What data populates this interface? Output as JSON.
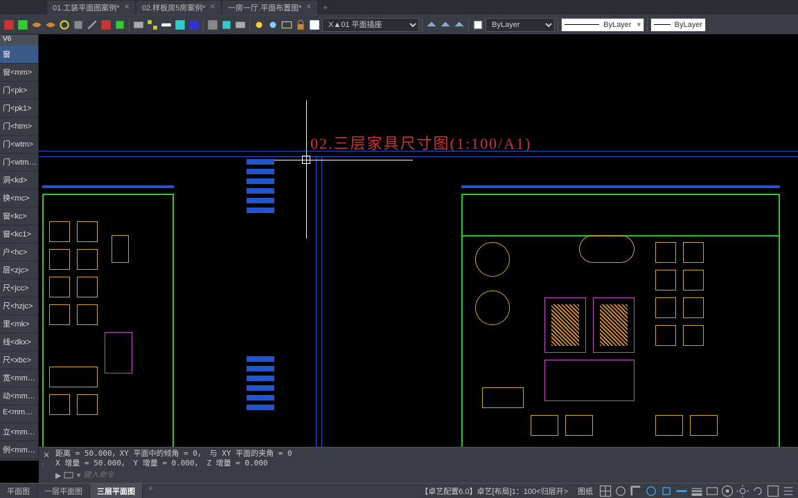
{
  "tabs": [
    {
      "label": "01.工装平面图案例*"
    },
    {
      "label": "02.样板房5房案例*"
    },
    {
      "label": "一房一厅.平面布置图*"
    }
  ],
  "toolbar": {
    "layer_current": "X▲01 平面插座",
    "bylayer1": "ByLayer",
    "bylayer2": "ByLayer",
    "bylayer3": "ByLayer"
  },
  "sidebar": {
    "header": "V6",
    "items": [
      "窗",
      "窗<mm>",
      "门<pk>",
      "门<pk1>",
      "门<htm>",
      "门<wtm>",
      "门<wtm…",
      "洞<kd>",
      "换<mc>",
      "窗<kc>",
      "窗<kc1>",
      "户<hc>",
      "层<zjc>",
      "尺<jcc>",
      "尺<hzjc>",
      "里<mk>",
      "线<dkx>",
      "尺<xbc>",
      "宽<mm…",
      "动<mm…",
      "E<mm…",
      "立<mm…",
      "例<mm…"
    ]
  },
  "canvas": {
    "title": "02.三层家具尺寸图(1:100/A1)"
  },
  "command": {
    "line1": "距离 = 50.000，XY 平面中的倾角 = 0，   与 XY 平面的夹角 = 0",
    "line2": "X 增量 = 50.000，  Y 增量 = 0.000，   Z 增量 = 0.000",
    "placeholder": "键入命令"
  },
  "layout_tabs": [
    {
      "label": "平面图"
    },
    {
      "label": "一层平面图"
    },
    {
      "label": "三层平面图"
    }
  ],
  "status": {
    "config": "【卓艺配置6.0】卓艺[布局]1：100<归层开>",
    "paper": "图纸"
  }
}
